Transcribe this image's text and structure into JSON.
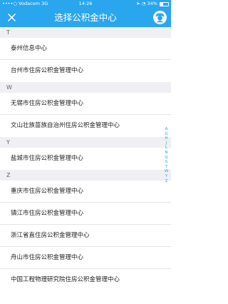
{
  "status_bar": {
    "carrier": "••••○ Vodacom",
    "network": "3G",
    "time": "14:26",
    "battery": "34%",
    "battery_level": 0.34
  },
  "navbar": {
    "title": "选择公积金中心",
    "close_icon": "close-icon",
    "avatar_icon": "avatar-icon"
  },
  "sections": [
    {
      "letter": "T",
      "items": [
        "泰州信息中心",
        "台州市住房公积金管理中心"
      ]
    },
    {
      "letter": "W",
      "items": [
        "无锡市住房公积金管理中心",
        "文山壮族苗族自治州住房公积金管理中心"
      ]
    },
    {
      "letter": "Y",
      "items": [
        "盐城市住房公积金管理中心"
      ]
    },
    {
      "letter": "Z",
      "items": [
        "重庆市住房公积金管理中心",
        "镇江市住房公积金管理中心",
        "浙江省直住房公积金管理中心",
        "舟山市住房公积金管理中心",
        "中国工程物理研究院住房公积金管理中心"
      ]
    }
  ],
  "index_letters": [
    "A",
    "G",
    "H",
    "J",
    "L",
    "N",
    "Q",
    "S",
    "T",
    "W",
    "Y",
    "Z"
  ],
  "colors": {
    "accent": "#2aa6ee",
    "section_bg": "#efeff4"
  }
}
